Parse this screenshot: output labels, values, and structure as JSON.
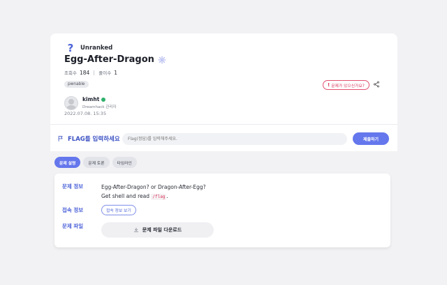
{
  "problem": {
    "rank": "Unranked",
    "title": "Egg-After-Dragon",
    "views_label": "조회수",
    "views": "184",
    "solves_label": "풀이수",
    "solves": "1",
    "tag": "pwnable",
    "report_label": "문제가 있으신가요?"
  },
  "author": {
    "name": "kimht",
    "role": "Dreamhack 관리자",
    "date": "2022.07.08. 15:35"
  },
  "flag": {
    "label": "FLAG를 입력하세요",
    "placeholder": "Flag(정답)를 입력해주세요.",
    "submit": "제출하기"
  },
  "tabs": [
    {
      "label": "문제 설명",
      "active": true
    },
    {
      "label": "문제 토론",
      "active": false
    },
    {
      "label": "타임라인",
      "active": false
    }
  ],
  "details": {
    "info_label": "문제 정보",
    "desc_line1": "Egg-After-Dragon? or Dragon-After-Egg?",
    "desc_line2": "Get shell and read",
    "desc_code": "/flag",
    "desc_end": ".",
    "conn_label": "접속 정보",
    "conn_button": "접속 정보 보기",
    "file_label": "문제 파일",
    "download_button": "문제 파일 다운로드"
  },
  "colors": {
    "accent": "#6577ec",
    "report": "#d8345a",
    "verified": "#2fb06b"
  }
}
